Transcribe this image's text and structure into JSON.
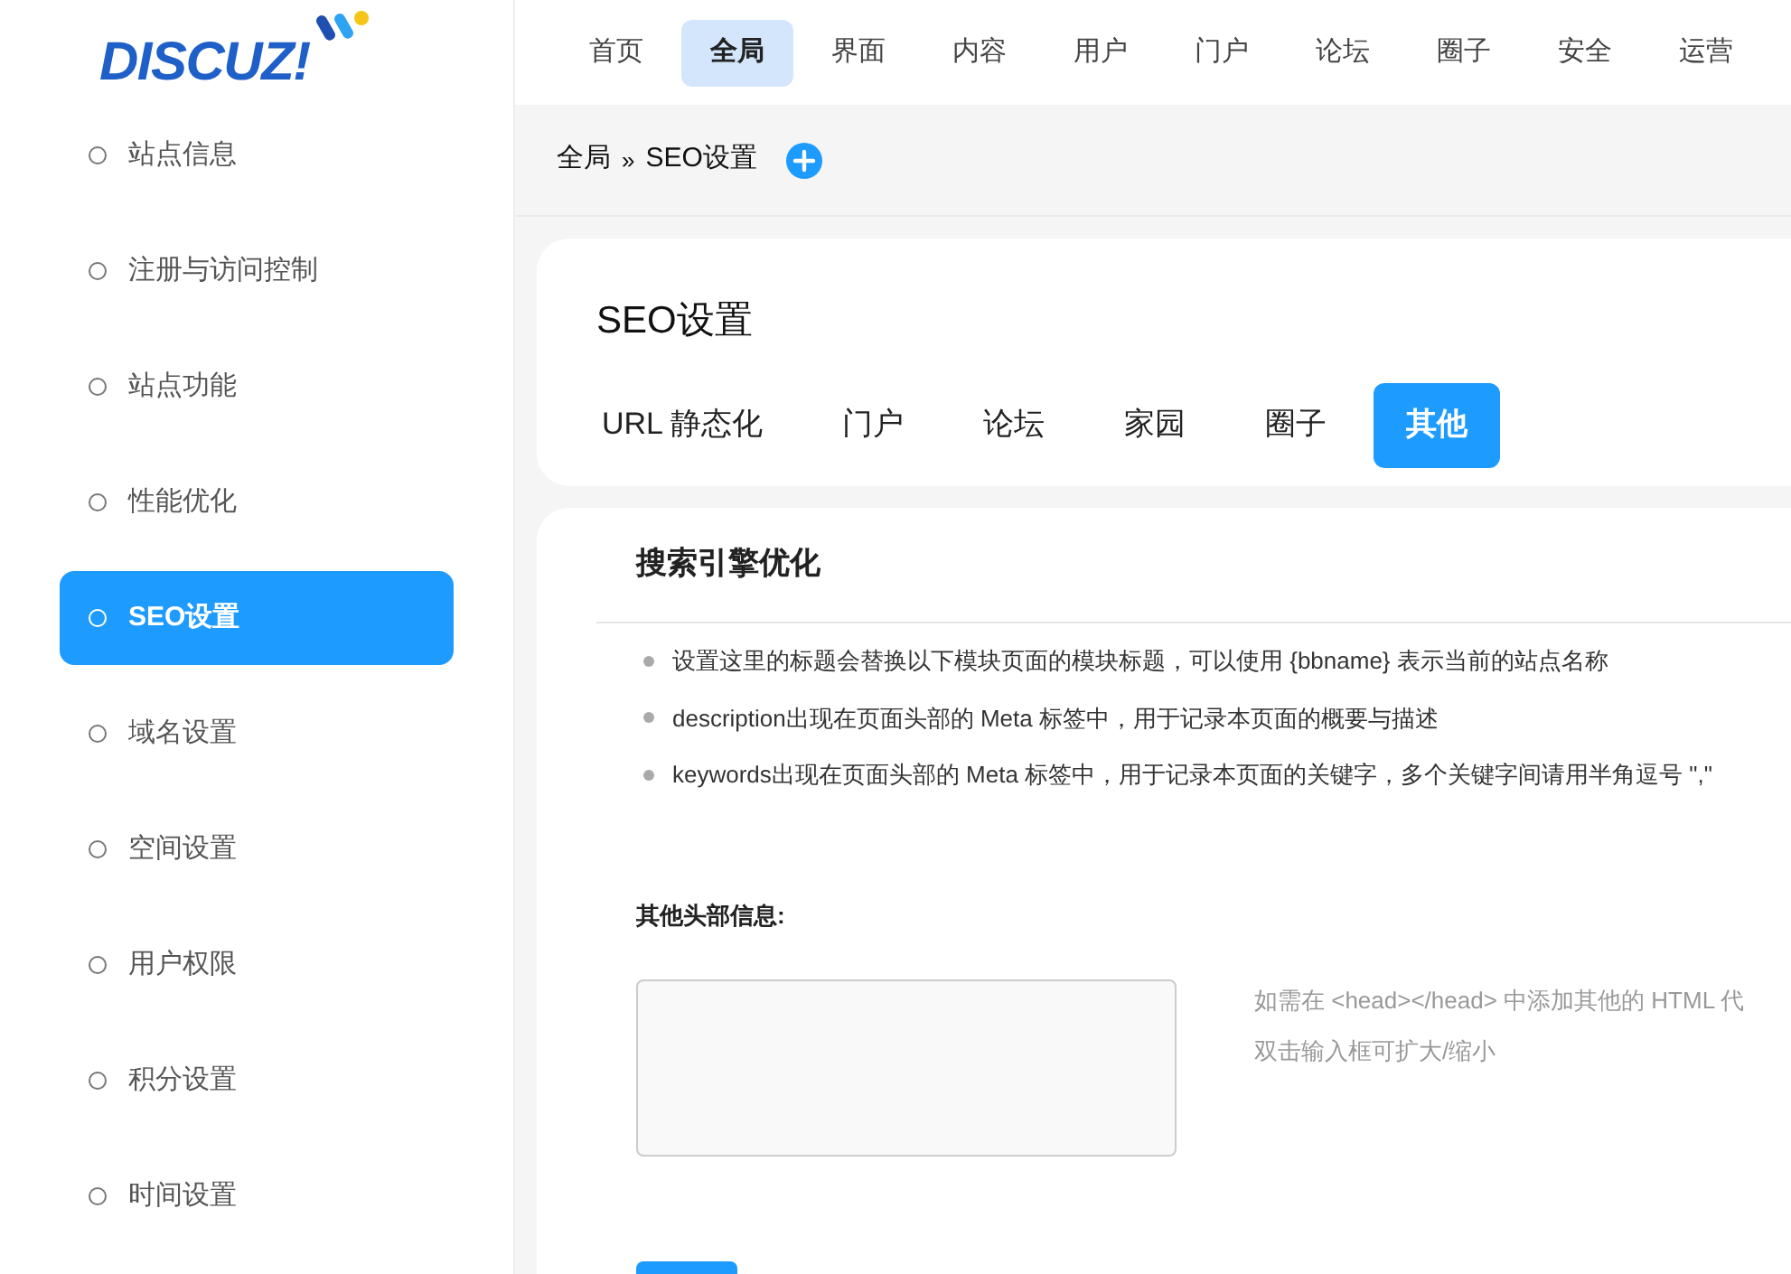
{
  "logo": {
    "text": "DISCUZ!"
  },
  "sidebar": {
    "items": [
      {
        "label": "站点信息",
        "selected": false
      },
      {
        "label": "注册与访问控制",
        "selected": false
      },
      {
        "label": "站点功能",
        "selected": false
      },
      {
        "label": "性能优化",
        "selected": false
      },
      {
        "label": "SEO设置",
        "selected": true
      },
      {
        "label": "域名设置",
        "selected": false
      },
      {
        "label": "空间设置",
        "selected": false
      },
      {
        "label": "用户权限",
        "selected": false
      },
      {
        "label": "积分设置",
        "selected": false
      },
      {
        "label": "时间设置",
        "selected": false
      }
    ]
  },
  "top_nav": {
    "items": [
      {
        "label": "首页",
        "selected": false
      },
      {
        "label": "全局",
        "selected": true
      },
      {
        "label": "界面",
        "selected": false
      },
      {
        "label": "内容",
        "selected": false
      },
      {
        "label": "用户",
        "selected": false
      },
      {
        "label": "门户",
        "selected": false
      },
      {
        "label": "论坛",
        "selected": false
      },
      {
        "label": "圈子",
        "selected": false
      },
      {
        "label": "安全",
        "selected": false
      },
      {
        "label": "运营",
        "selected": false
      }
    ]
  },
  "breadcrumb": {
    "parent": "全局",
    "separator": "»",
    "current": "SEO设置"
  },
  "page_title": "SEO设置",
  "tabs": [
    {
      "label": "URL 静态化",
      "selected": false
    },
    {
      "label": "门户",
      "selected": false
    },
    {
      "label": "论坛",
      "selected": false
    },
    {
      "label": "家园",
      "selected": false
    },
    {
      "label": "圈子",
      "selected": false
    },
    {
      "label": "其他",
      "selected": true
    }
  ],
  "section": {
    "title": "搜索引擎优化",
    "tips": [
      "设置这里的标题会替换以下模块页面的模块标题，可以使用 {bbname} 表示当前的站点名称",
      "description出现在页面头部的 Meta 标签中，用于记录本页面的概要与描述",
      "keywords出现在页面头部的 Meta 标签中，用于记录本页面的关键字，多个关键字间请用半角逗号 \",\""
    ],
    "field": {
      "label": "其他头部信息:",
      "hint_lines": [
        "如需在 <head></head> 中添加其他的 HTML 代",
        "双击输入框可扩大/缩小"
      ]
    }
  }
}
